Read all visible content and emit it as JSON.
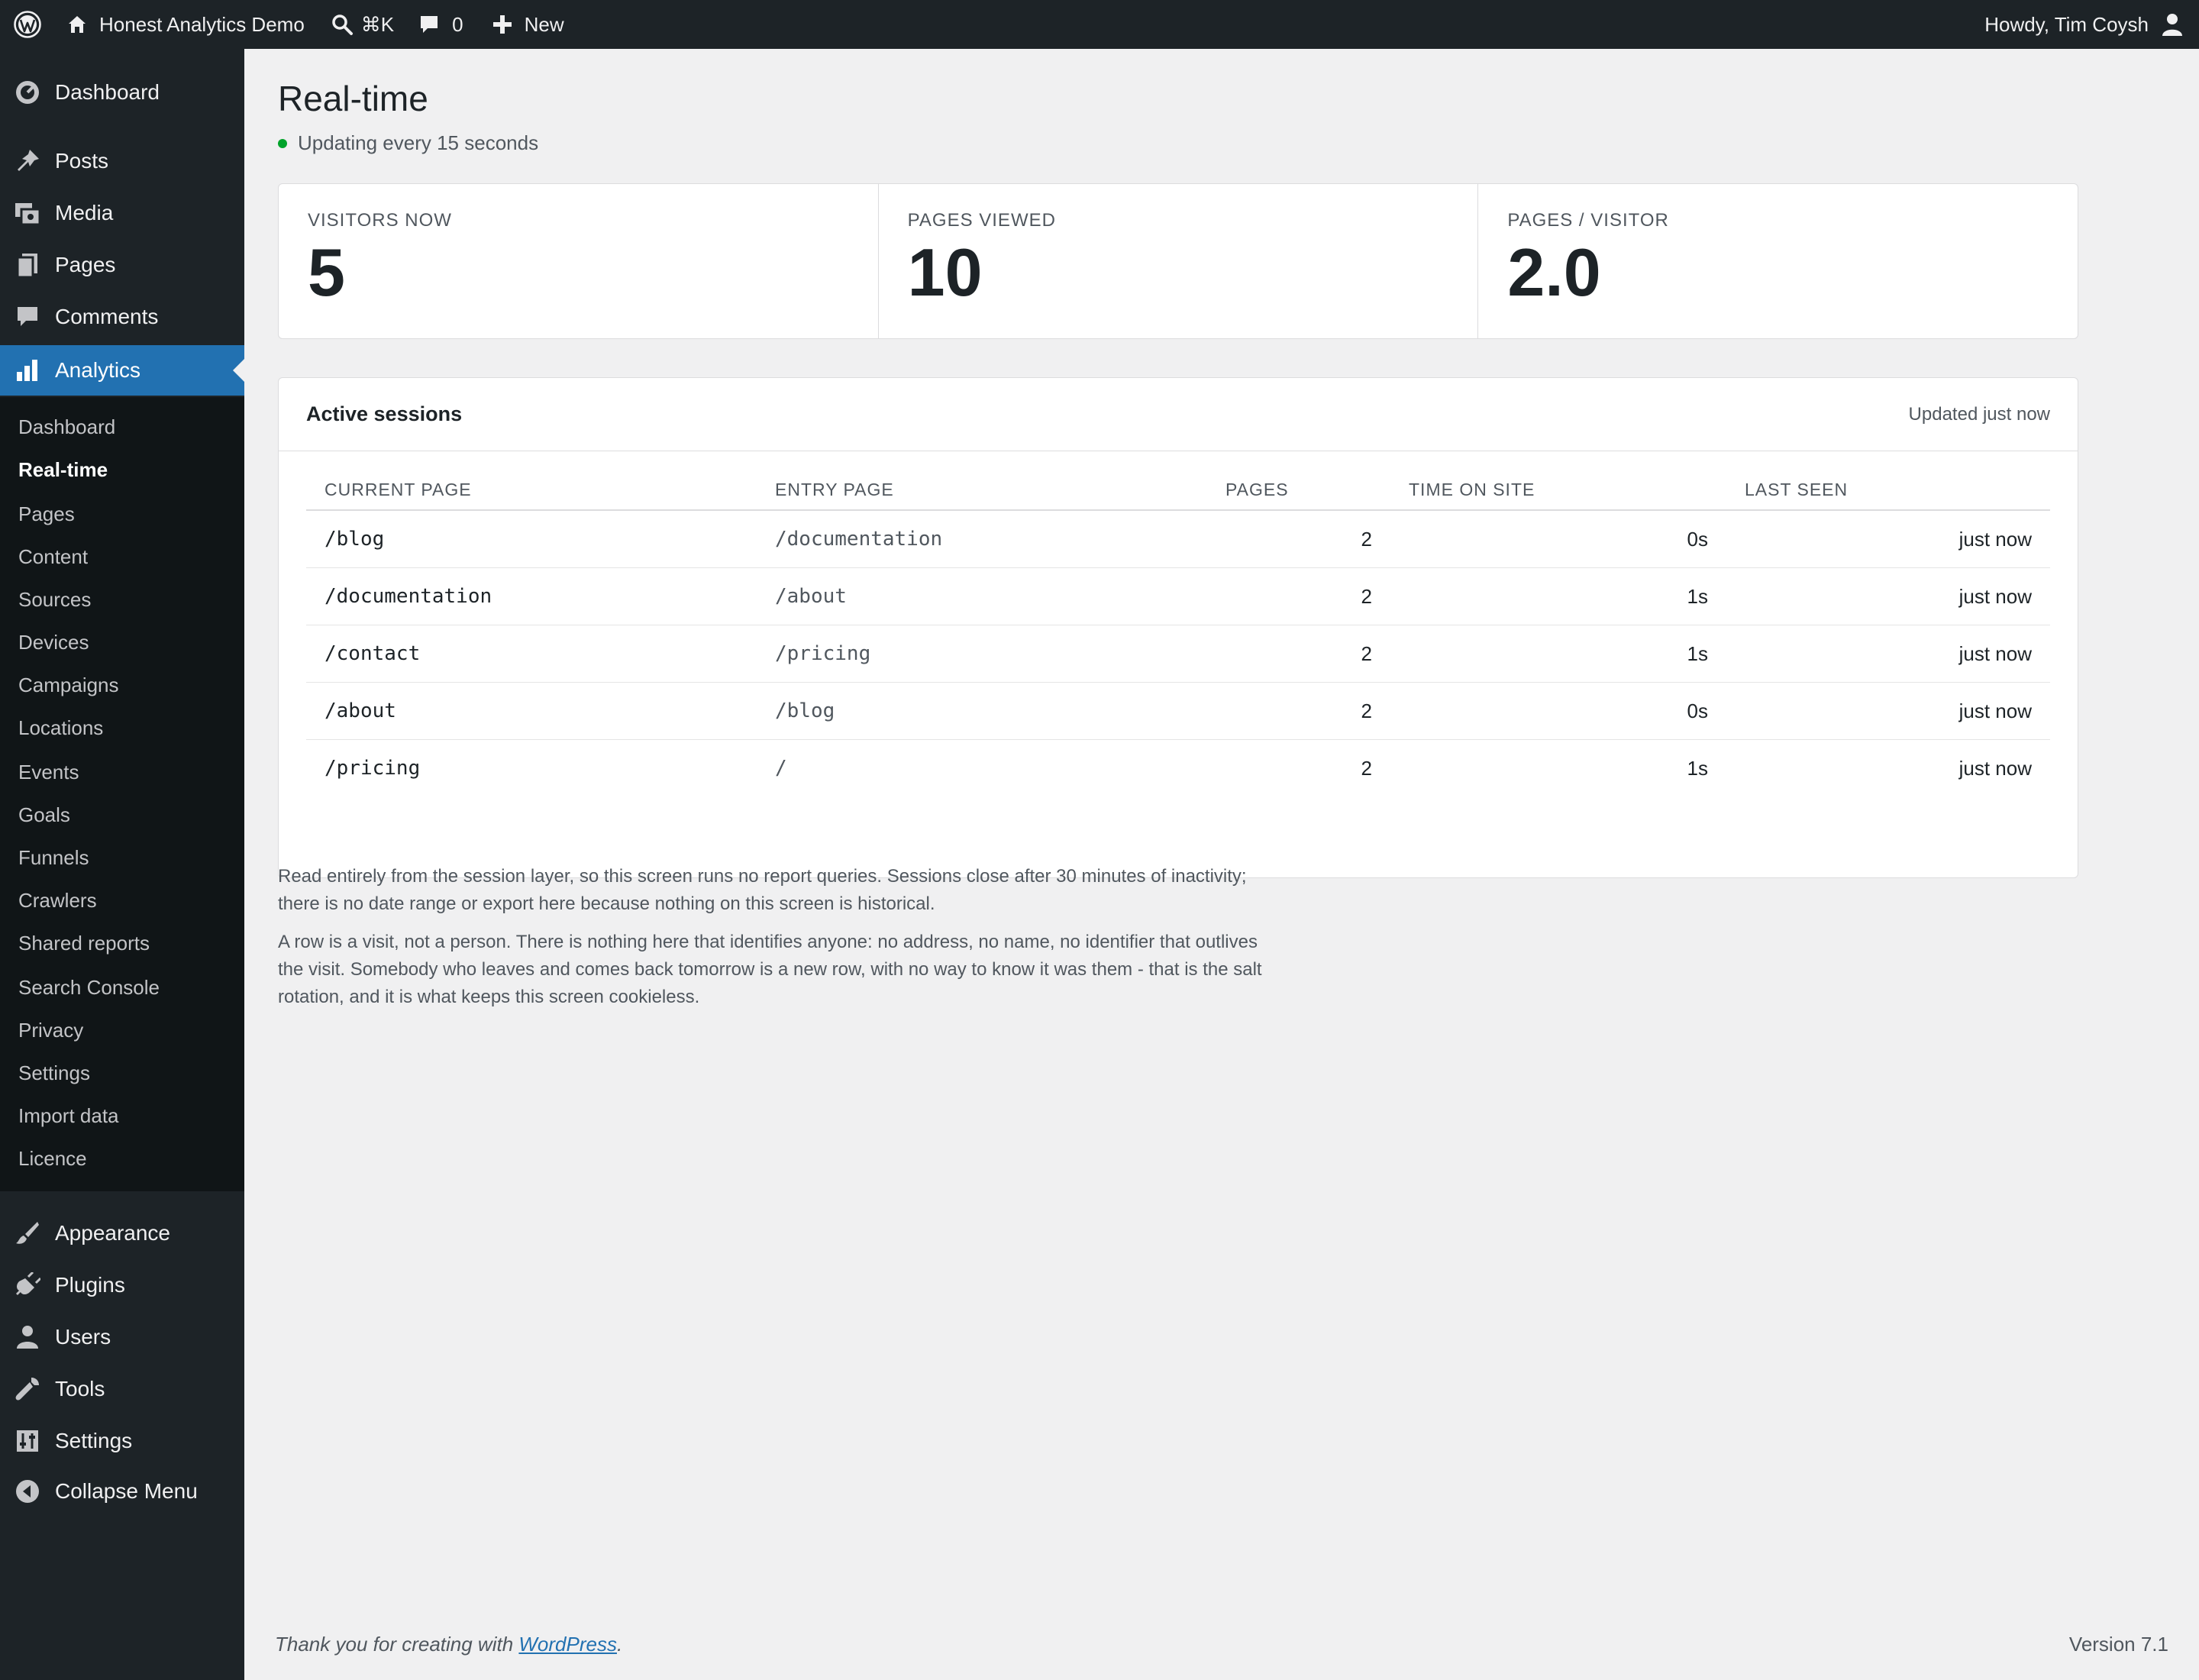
{
  "admin_bar": {
    "site_name": "Honest Analytics Demo",
    "search_shortcut": "⌘K",
    "comments_count": "0",
    "new_label": "New",
    "greeting": "Howdy, Tim Coysh"
  },
  "sidebar": {
    "top_items": [
      {
        "label": "Dashboard",
        "icon": "dashboard-icon"
      },
      {
        "label": "Posts",
        "icon": "pin-icon"
      },
      {
        "label": "Media",
        "icon": "media-icon"
      },
      {
        "label": "Pages",
        "icon": "pages-icon"
      },
      {
        "label": "Comments",
        "icon": "comment-icon"
      },
      {
        "label": "Analytics",
        "icon": "chart-icon",
        "current": true
      }
    ],
    "analytics_submenu": [
      "Dashboard",
      "Real-time",
      "Pages",
      "Content",
      "Sources",
      "Devices",
      "Campaigns",
      "Locations",
      "Events",
      "Goals",
      "Funnels",
      "Crawlers",
      "Shared reports",
      "Search Console",
      "Privacy",
      "Settings",
      "Import data",
      "Licence"
    ],
    "current_submenu": "Real-time",
    "bottom_items": [
      {
        "label": "Appearance",
        "icon": "brush-icon"
      },
      {
        "label": "Plugins",
        "icon": "plugin-icon"
      },
      {
        "label": "Users",
        "icon": "user-icon"
      },
      {
        "label": "Tools",
        "icon": "wrench-icon"
      },
      {
        "label": "Settings",
        "icon": "sliders-icon"
      },
      {
        "label": "Collapse Menu",
        "icon": "collapse-icon"
      }
    ]
  },
  "page": {
    "title": "Real-time",
    "status": "Updating every 15 seconds",
    "status_color": "#00a32a"
  },
  "stats": [
    {
      "label": "VISITORS NOW",
      "value": "5"
    },
    {
      "label": "PAGES VIEWED",
      "value": "10"
    },
    {
      "label": "PAGES / VISITOR",
      "value": "2.0"
    }
  ],
  "sessions": {
    "title": "Active sessions",
    "updated": "Updated just now",
    "columns": [
      "CURRENT PAGE",
      "ENTRY PAGE",
      "PAGES",
      "TIME ON SITE",
      "LAST SEEN"
    ],
    "rows": [
      {
        "current": "/blog",
        "entry": "/documentation",
        "pages": "2",
        "time": "0s",
        "last_seen": "just now"
      },
      {
        "current": "/documentation",
        "entry": "/about",
        "pages": "2",
        "time": "1s",
        "last_seen": "just now"
      },
      {
        "current": "/contact",
        "entry": "/pricing",
        "pages": "2",
        "time": "1s",
        "last_seen": "just now"
      },
      {
        "current": "/about",
        "entry": "/blog",
        "pages": "2",
        "time": "0s",
        "last_seen": "just now"
      },
      {
        "current": "/pricing",
        "entry": "/",
        "pages": "2",
        "time": "1s",
        "last_seen": "just now"
      }
    ]
  },
  "notes": [
    "Read entirely from the session layer, so this screen runs no report queries. Sessions close after 30 minutes of inactivity; there is no date range or export here because nothing on this screen is historical.",
    "A row is a visit, not a person. There is nothing here that identifies anyone: no address, no name, no identifier that outlives the visit. Somebody who leaves and comes back tomorrow is a new row, with no way to know it was them - that is the salt rotation, and it is what keeps this screen cookieless."
  ],
  "footer": {
    "thanks_prefix": "Thank you for creating with ",
    "link_text": "WordPress",
    "thanks_suffix": ".",
    "version": "Version 7.1"
  },
  "colors": {
    "admin_bg": "#1d2327",
    "accent": "#2271b1",
    "page_bg": "#f0f0f1"
  }
}
